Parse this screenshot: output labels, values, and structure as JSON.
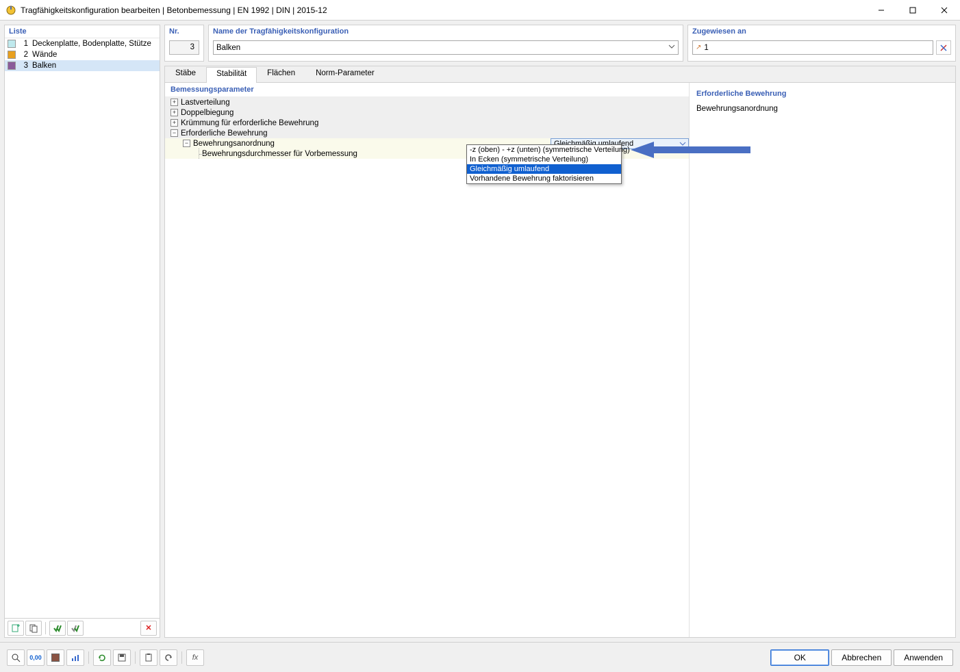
{
  "window": {
    "title": "Tragfähigkeitskonfiguration bearbeiten | Betonbemessung | EN 1992 | DIN | 2015-12"
  },
  "left": {
    "header": "Liste",
    "items": [
      {
        "num": "1",
        "label": "Deckenplatte, Bodenplatte, Stütze",
        "color": "#bfe9ed",
        "selected": false
      },
      {
        "num": "2",
        "label": "Wände",
        "color": "#e8a01e",
        "selected": false
      },
      {
        "num": "3",
        "label": "Balken",
        "color": "#8a5b9a",
        "selected": true
      }
    ]
  },
  "top": {
    "nr_label": "Nr.",
    "nr_value": "3",
    "name_label": "Name der Tragfähigkeitskonfiguration",
    "name_value": "Balken",
    "assign_label": "Zugewiesen an",
    "assign_value": "1"
  },
  "tabs": {
    "items": [
      "Stäbe",
      "Stabilität",
      "Flächen",
      "Norm-Parameter"
    ],
    "active_index": 1
  },
  "params": {
    "header": "Bemessungsparameter",
    "rows": [
      {
        "label": "Lastverteilung",
        "toggle": "+",
        "indent": 0,
        "gray": true
      },
      {
        "label": "Doppelbiegung",
        "toggle": "+",
        "indent": 0,
        "gray": true
      },
      {
        "label": "Krümmung für erforderliche Bewehrung",
        "toggle": "+",
        "indent": 0,
        "gray": true
      },
      {
        "label": "Erforderliche Bewehrung",
        "toggle": "−",
        "indent": 0,
        "gray": true
      },
      {
        "label": "Bewehrungsanordnung",
        "toggle": "−",
        "indent": 1,
        "gray": false,
        "has_combo": true
      },
      {
        "label": "Bewehrungsdurchmesser für Vorbemessung",
        "toggle": "",
        "indent": 2,
        "gray": false
      }
    ],
    "combo_value": "Gleichmäßig umlaufend",
    "dropdown": [
      {
        "label": "-z (oben) - +z (unten) (symmetrische Verteilung)",
        "hl": false
      },
      {
        "label": "In Ecken (symmetrische Verteilung)",
        "hl": false
      },
      {
        "label": "Gleichmäßig umlaufend",
        "hl": true
      },
      {
        "label": "Vorhandene Bewehrung faktorisieren",
        "hl": false
      }
    ]
  },
  "side": {
    "header": "Erforderliche Bewehrung",
    "text": "Bewehrungsanordnung"
  },
  "buttons": {
    "ok": "OK",
    "cancel": "Abbrechen",
    "apply": "Anwenden"
  }
}
